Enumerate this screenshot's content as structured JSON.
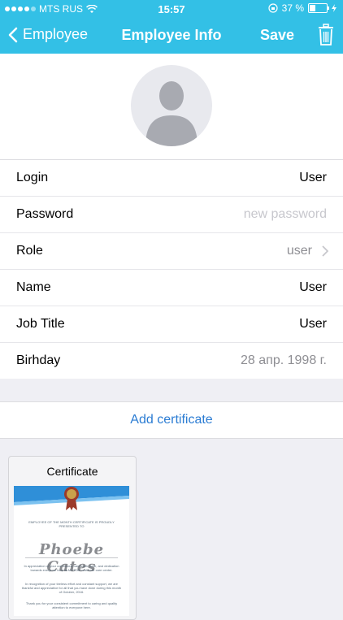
{
  "status": {
    "carrier": "MTS RUS",
    "time": "15:57",
    "battery": "37 %"
  },
  "nav": {
    "back_label": "Employee",
    "title": "Employee Info",
    "save_label": "Save"
  },
  "form": {
    "login_label": "Login",
    "login_value": "User",
    "password_label": "Password",
    "password_placeholder": "new password",
    "role_label": "Role",
    "role_value": "user",
    "name_label": "Name",
    "name_value": "User",
    "jobtitle_label": "Job Title",
    "jobtitle_value": "User",
    "birthday_label": "Birhday",
    "birthday_value": "28 апр. 1998 г."
  },
  "certificates": {
    "add_label": "Add certificate",
    "card_title": "Certificate",
    "image": {
      "heading": "EMPLOYEE OF THE MONTH CERTIFICATE IS PROUDLY PRESENTED TO",
      "recipient": "Phoebe Cates",
      "para1": "In appreciation of your continuous hard work, care, and dedication towards everyone here at MLOOM customer care center.",
      "para2": "In recognition of your tireless effort and constant support, we are thankful and appreciative for all that you have done during this month of October, 2016.",
      "para3": "Thank you for your consistent commitment to caring and quality attention to everyone here."
    }
  },
  "colors": {
    "accent": "#33c0e6",
    "link": "#2b7cd3"
  }
}
